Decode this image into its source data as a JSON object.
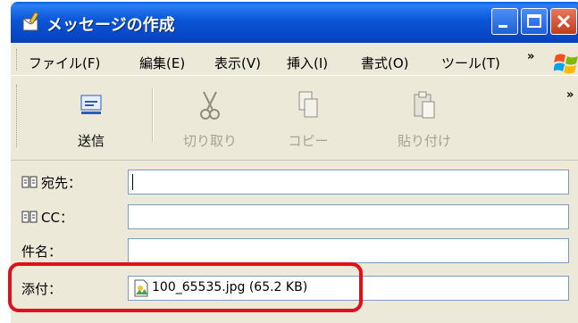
{
  "window": {
    "title": "メッセージの作成"
  },
  "menu": {
    "items": [
      "ファイル(F)",
      "編集(E)",
      "表示(V)",
      "挿入(I)",
      "書式(O)",
      "ツール(T)"
    ],
    "overflow": "»"
  },
  "toolbar": {
    "send": "送信",
    "cut": "切り取り",
    "copy": "コピー",
    "paste": "貼り付け",
    "overflow": "»"
  },
  "fields": {
    "to_label": "宛先：",
    "cc_label": "CC：",
    "subject_label": "件名：",
    "attach_label": "添付：",
    "to_value": "",
    "cc_value": "",
    "subject_value": "",
    "attachment": "100_65535.jpg (65.2 KB)"
  },
  "icons": [
    "compose-icon",
    "minimize-icon",
    "maximize-icon",
    "close-icon",
    "windows-logo-icon",
    "send-icon",
    "cut-icon",
    "copy-icon",
    "paste-icon",
    "address-book-icon",
    "image-file-icon"
  ],
  "colors": {
    "titlebar": "#0a55d8",
    "highlight": "#e0101a",
    "window_bg": "#ece9d8"
  }
}
